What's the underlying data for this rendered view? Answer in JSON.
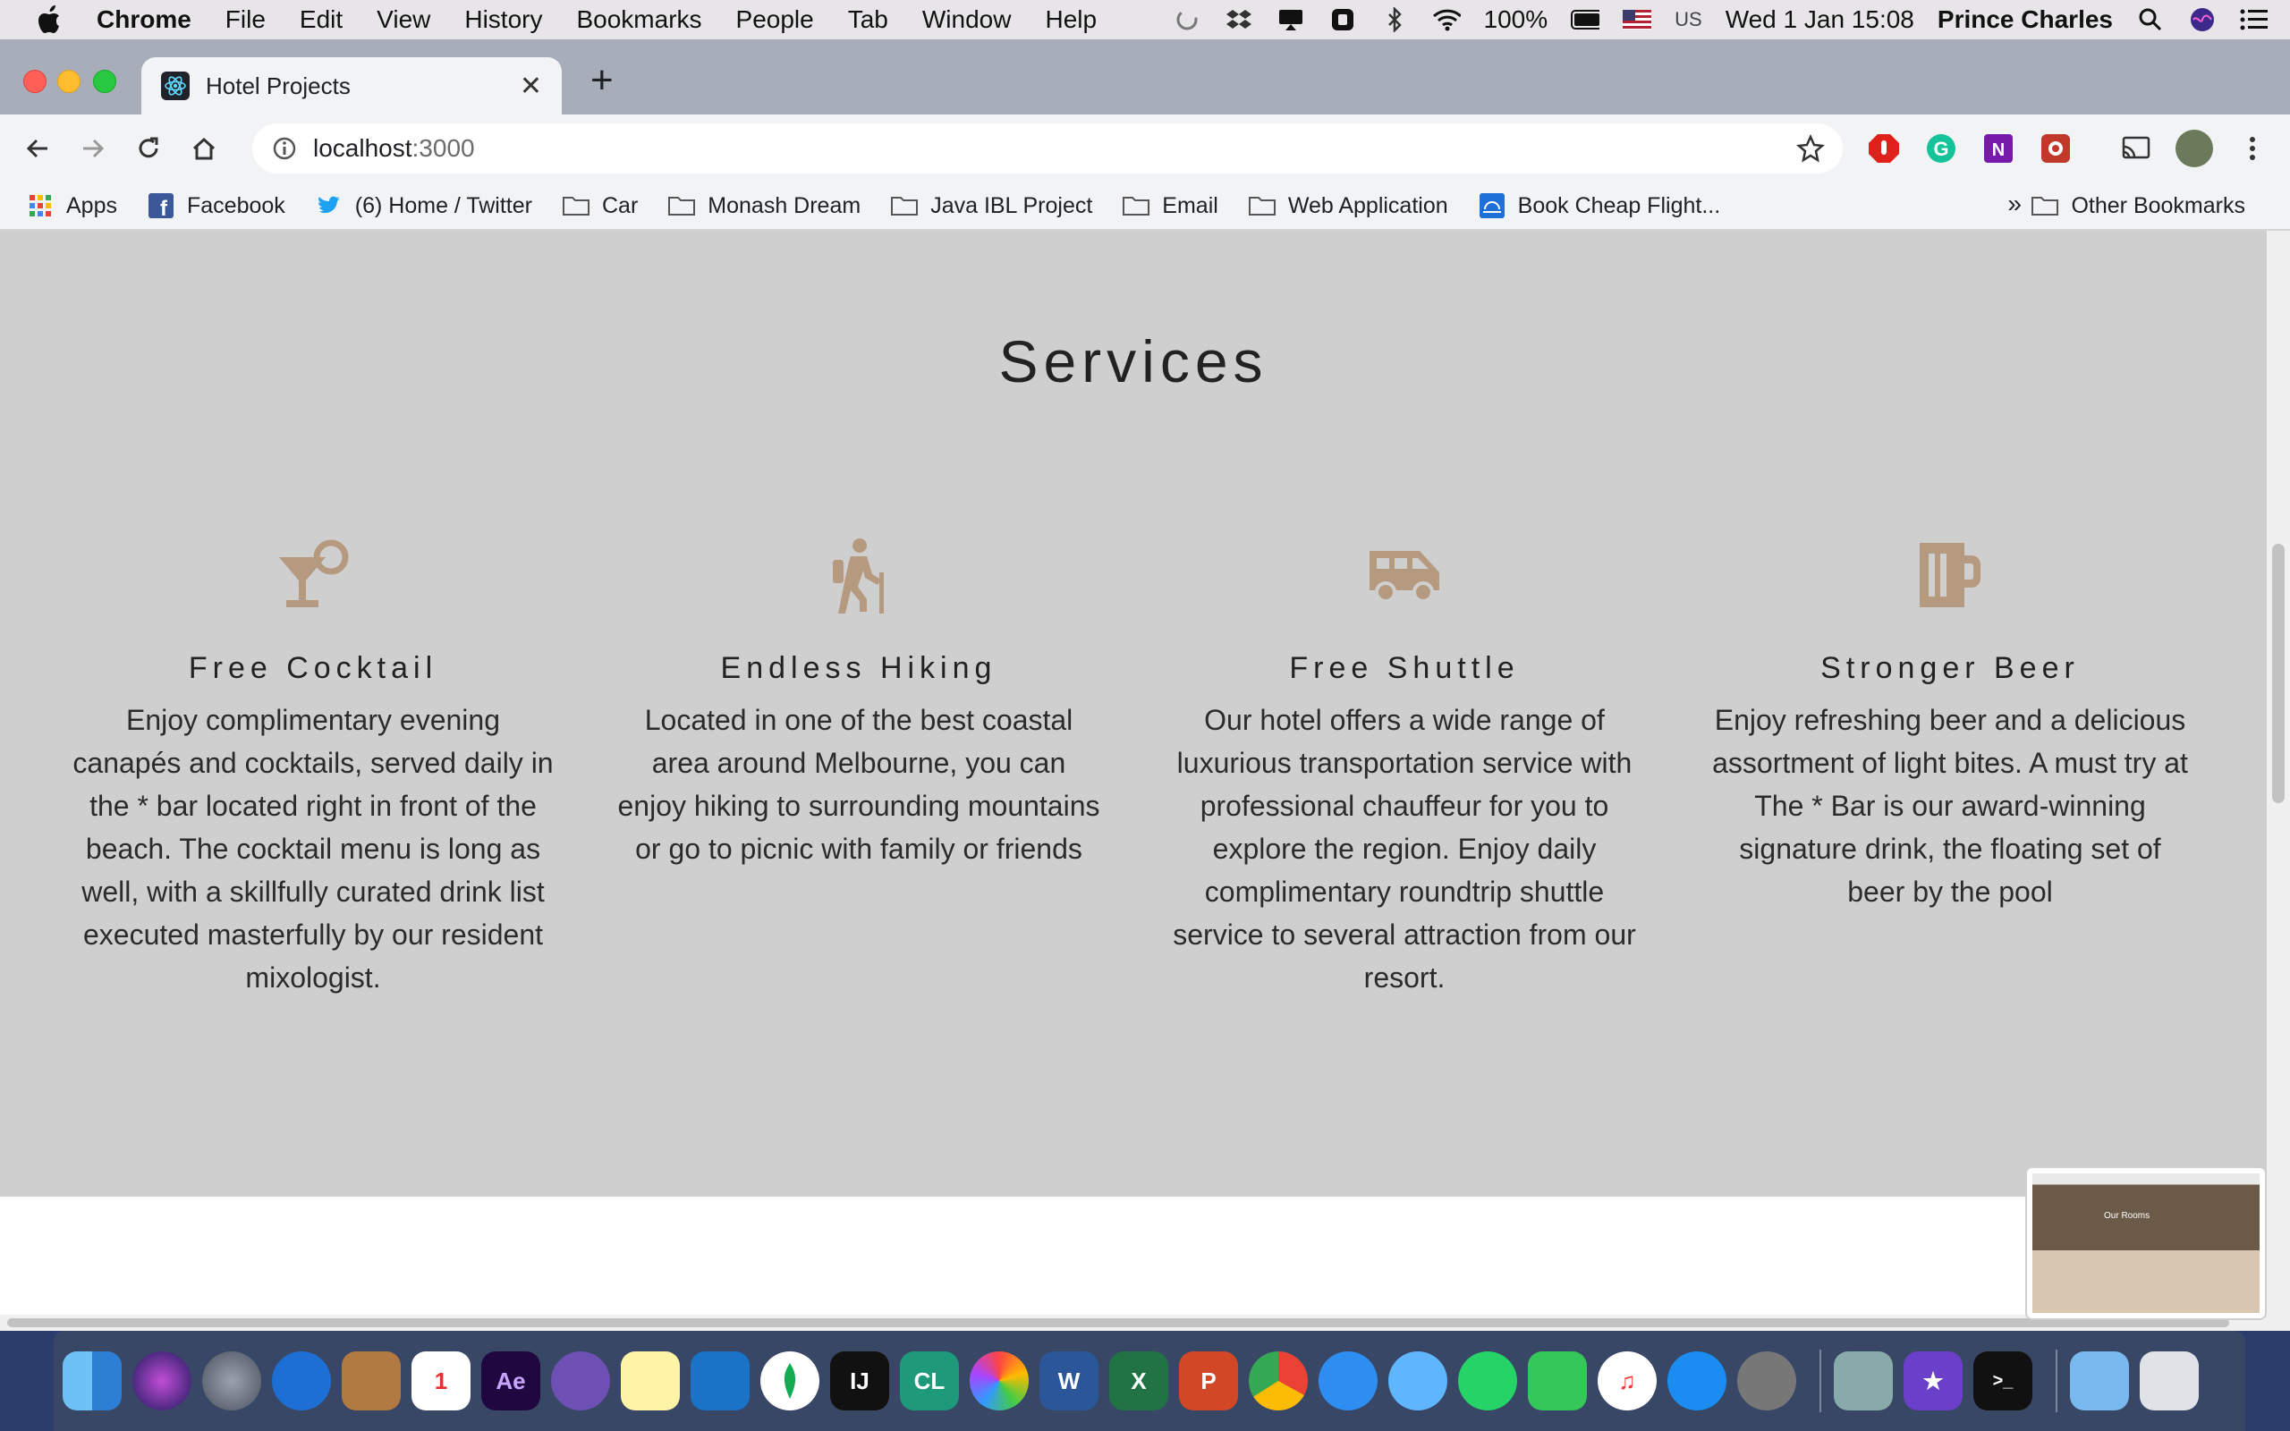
{
  "menubar": {
    "app": "Chrome",
    "items": [
      "File",
      "Edit",
      "View",
      "History",
      "Bookmarks",
      "People",
      "Tab",
      "Window",
      "Help"
    ],
    "battery": "100%",
    "input_source": "US",
    "clock": "Wed 1 Jan  15:08",
    "user": "Prince Charles"
  },
  "browser": {
    "tab_title": "Hotel Projects",
    "url_host": "localhost",
    "url_port": ":3000"
  },
  "bookmarks": {
    "items": [
      "Apps",
      "Facebook",
      "(6) Home / Twitter",
      "Car",
      "Monash Dream",
      "Java IBL Project",
      "Email",
      "Web Application",
      "Book Cheap Flight..."
    ],
    "more": "»",
    "other": "Other Bookmarks"
  },
  "services": {
    "heading": "Services",
    "cards": [
      {
        "icon": "cocktail-icon",
        "title": "Free Cocktail",
        "text": "Enjoy complimentary evening canapés and cocktails, served daily in the * bar located right in front of the beach. The cocktail menu is long as well, with a skillfully curated drink list executed masterfully by our resident mixologist."
      },
      {
        "icon": "hiking-icon",
        "title": "Endless Hiking",
        "text": "Located in one of the best coastal area around Melbourne, you can enjoy hiking to surrounding mountains or go to picnic with family or friends"
      },
      {
        "icon": "shuttle-icon",
        "title": "Free Shuttle",
        "text": "Our hotel offers a wide range of luxurious transportation service with professional chauffeur for you to explore the region. Enjoy daily complimentary roundtrip shuttle service to several attraction from our resort."
      },
      {
        "icon": "beer-icon",
        "title": "Stronger Beer",
        "text": "Enjoy refreshing beer and a delicious assortment of light bites. A must try at The * Bar is our award-winning signature drink, the floating set of beer by the pool"
      }
    ]
  },
  "thumbnail": {
    "title": "Our Rooms"
  },
  "colors": {
    "icon_accent": "#b59a80",
    "section_bg": "#cfcfcf"
  }
}
